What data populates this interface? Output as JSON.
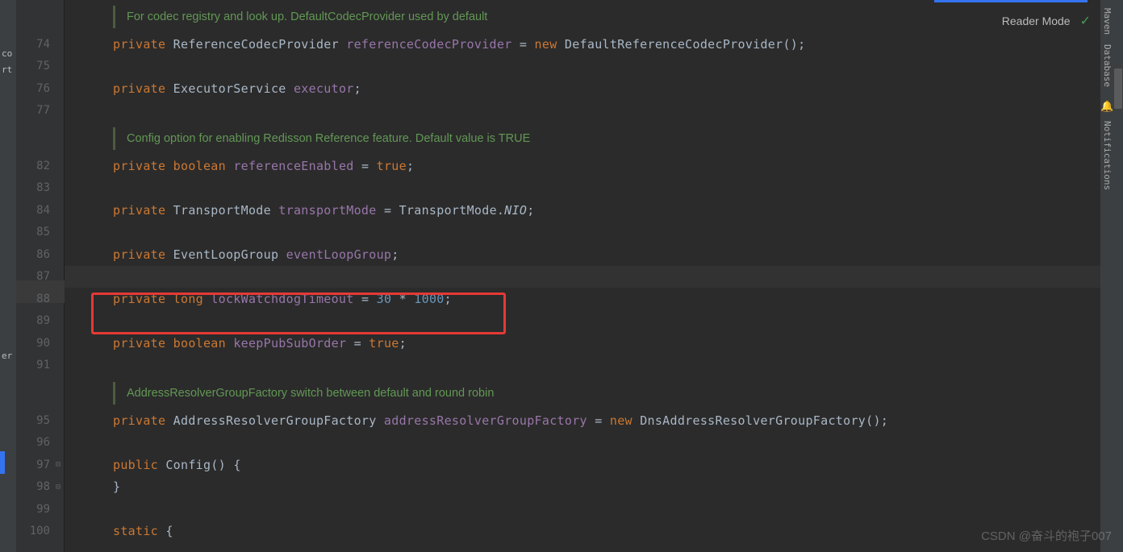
{
  "controls": {
    "reader_mode": "Reader Mode"
  },
  "right_strip": {
    "maven": "Maven",
    "database": "Database",
    "notifications": "Notifications"
  },
  "left_strip": {
    "top": "co",
    "second": "rt",
    "bottom": "er"
  },
  "docs": {
    "codec": "For codec registry and look up. DefaultCodecProvider used by default",
    "reference": "Config option for enabling Redisson Reference feature. Default value is TRUE",
    "address": "AddressResolverGroupFactory switch between default and round robin"
  },
  "lines": [
    {
      "no": "74",
      "tokens": [
        {
          "t": "private ",
          "c": "kw"
        },
        {
          "t": "ReferenceCodecProvider ",
          "c": "typ"
        },
        {
          "t": "referenceCodecProvider",
          "c": "fld"
        },
        {
          "t": " = ",
          "c": "op"
        },
        {
          "t": "new ",
          "c": "kw"
        },
        {
          "t": "DefaultReferenceCodecProvider();",
          "c": "typ"
        }
      ]
    },
    {
      "no": "75",
      "tokens": []
    },
    {
      "no": "76",
      "tokens": [
        {
          "t": "private ",
          "c": "kw"
        },
        {
          "t": "ExecutorService ",
          "c": "typ"
        },
        {
          "t": "executor",
          "c": "fld"
        },
        {
          "t": ";",
          "c": "op"
        }
      ]
    },
    {
      "no": "77",
      "tokens": []
    },
    {
      "no": "82",
      "tokens": [
        {
          "t": "private ",
          "c": "kw"
        },
        {
          "t": "boolean ",
          "c": "kw"
        },
        {
          "t": "referenceEnabled",
          "c": "fld"
        },
        {
          "t": " = ",
          "c": "op"
        },
        {
          "t": "true",
          "c": "kw"
        },
        {
          "t": ";",
          "c": "op"
        }
      ]
    },
    {
      "no": "83",
      "tokens": []
    },
    {
      "no": "84",
      "tokens": [
        {
          "t": "private ",
          "c": "kw"
        },
        {
          "t": "TransportMode ",
          "c": "typ"
        },
        {
          "t": "transportMode",
          "c": "fld"
        },
        {
          "t": " = TransportMode.",
          "c": "typ"
        },
        {
          "t": "NIO",
          "c": "ital-typ"
        },
        {
          "t": ";",
          "c": "op"
        }
      ]
    },
    {
      "no": "85",
      "tokens": []
    },
    {
      "no": "86",
      "tokens": [
        {
          "t": "private ",
          "c": "kw"
        },
        {
          "t": "EventLoopGroup ",
          "c": "typ"
        },
        {
          "t": "eventLoopGroup",
          "c": "fld"
        },
        {
          "t": ";",
          "c": "op"
        }
      ]
    },
    {
      "no": "87",
      "tokens": []
    },
    {
      "no": "88",
      "tokens": [
        {
          "t": "private ",
          "c": "kw"
        },
        {
          "t": "long ",
          "c": "kw"
        },
        {
          "t": "lockWatchdogTimeout",
          "c": "fld"
        },
        {
          "t": " = ",
          "c": "op"
        },
        {
          "t": "30",
          "c": "num"
        },
        {
          "t": " * ",
          "c": "op"
        },
        {
          "t": "1000",
          "c": "num"
        },
        {
          "t": ";",
          "c": "op"
        }
      ]
    },
    {
      "no": "89",
      "tokens": []
    },
    {
      "no": "90",
      "tokens": [
        {
          "t": "private ",
          "c": "kw"
        },
        {
          "t": "boolean ",
          "c": "kw"
        },
        {
          "t": "keepPubSubOrder",
          "c": "fld"
        },
        {
          "t": " = ",
          "c": "op"
        },
        {
          "t": "true",
          "c": "kw"
        },
        {
          "t": ";",
          "c": "op"
        }
      ]
    },
    {
      "no": "91",
      "tokens": []
    },
    {
      "no": "95",
      "tokens": [
        {
          "t": "private ",
          "c": "kw"
        },
        {
          "t": "AddressResolverGroupFactory ",
          "c": "typ"
        },
        {
          "t": "addressResolverGroupFactory",
          "c": "fld"
        },
        {
          "t": " = ",
          "c": "op"
        },
        {
          "t": "new ",
          "c": "kw"
        },
        {
          "t": "DnsAddressResolverGroupFactory();",
          "c": "typ"
        }
      ]
    },
    {
      "no": "96",
      "tokens": []
    },
    {
      "no": "97",
      "tokens": [
        {
          "t": "public ",
          "c": "kw"
        },
        {
          "t": "Config",
          "c": "typ"
        },
        {
          "t": "() {",
          "c": "op"
        }
      ]
    },
    {
      "no": "98",
      "tokens": [
        {
          "t": "}",
          "c": "op"
        }
      ]
    },
    {
      "no": "99",
      "tokens": []
    },
    {
      "no": "100",
      "tokens": [
        {
          "t": "static ",
          "c": "kw"
        },
        {
          "t": "{",
          "c": "op"
        }
      ]
    }
  ],
  "watermark": "CSDN @奋斗的袍子007"
}
